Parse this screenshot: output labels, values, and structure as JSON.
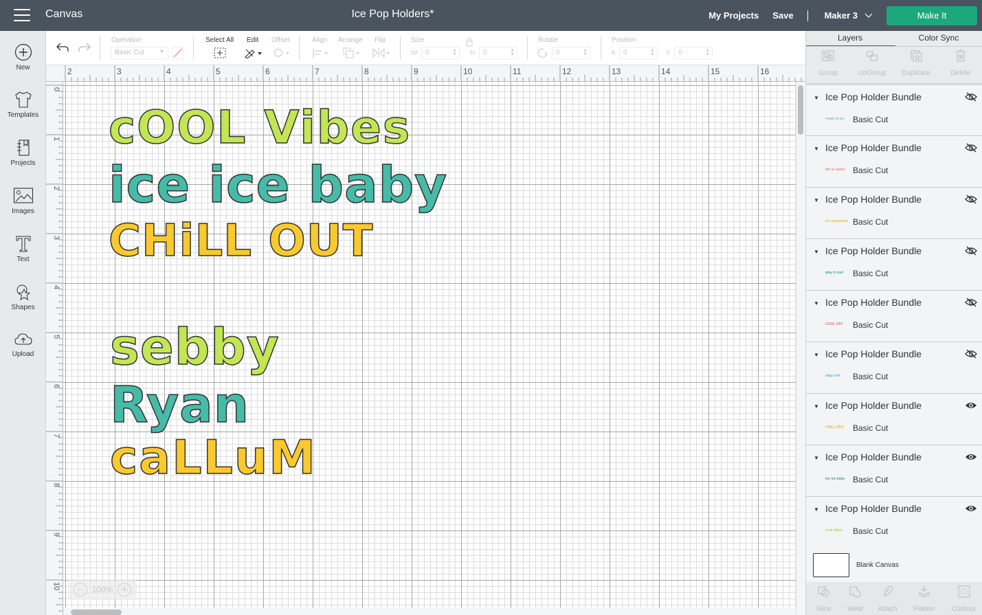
{
  "topbar": {
    "app_title": "Canvas",
    "document_title": "Ice Pop Holders*",
    "my_projects": "My Projects",
    "save": "Save",
    "separator": "|",
    "machine": "Maker 3",
    "make_it": "Make It"
  },
  "sidebar": {
    "items": [
      {
        "label": "New",
        "icon": "plus-circle-icon"
      },
      {
        "label": "Templates",
        "icon": "tshirt-icon"
      },
      {
        "label": "Projects",
        "icon": "notebook-icon"
      },
      {
        "label": "Images",
        "icon": "image-icon"
      },
      {
        "label": "Text",
        "icon": "text-icon"
      },
      {
        "label": "Shapes",
        "icon": "shapes-icon"
      },
      {
        "label": "Upload",
        "icon": "upload-cloud-icon"
      }
    ]
  },
  "toolbar": {
    "operation_label": "Operation",
    "operation_value": "Basic Cut",
    "select_all": "Select All",
    "edit": "Edit",
    "offset": "Offset",
    "align": "Align",
    "arrange": "Arrange",
    "flip": "Flip",
    "size": "Size",
    "w_label": "W",
    "w_value": "0",
    "h_label": "H",
    "h_value": "0",
    "rotate": "Rotate",
    "rotate_value": "0",
    "position": "Position",
    "x_label": "X",
    "x_value": "0",
    "y_label": "Y",
    "y_value": "0"
  },
  "rulers": {
    "top": [
      "2",
      "3",
      "4",
      "5",
      "6",
      "7",
      "8",
      "9",
      "10",
      "11",
      "12",
      "13",
      "14",
      "15",
      "16"
    ],
    "left": [
      "0",
      "1",
      "2",
      "3",
      "4",
      "5",
      "6",
      "7",
      "8",
      "9",
      "10"
    ]
  },
  "canvas": {
    "designs": [
      {
        "text": "cOOL Vibes",
        "color": "#c2e654"
      },
      {
        "text": "ice ice baby",
        "color": "#45bba8"
      },
      {
        "text": "CHiLL OUT",
        "color": "#f9c92e"
      },
      {
        "text": "sebby",
        "color": "#c2e654"
      },
      {
        "text": "Ryan",
        "color": "#45bba8"
      },
      {
        "text": "caLLuM",
        "color": "#f9c92e"
      }
    ],
    "zoom_level": "100%",
    "zoom_out": "−",
    "zoom_in": "+"
  },
  "panel": {
    "tabs": [
      "Layers",
      "Color Sync"
    ],
    "tools": [
      "Group",
      "UnGroup",
      "Duplicate",
      "Delete"
    ],
    "layers": [
      {
        "name": "Ice Pop Holder Bundle",
        "sub": "Basic Cut",
        "thumb": "ready to po",
        "thumb_color": "#7fc9b5",
        "visible": false
      },
      {
        "name": "Ice Pop Holder Bundle",
        "sub": "Basic Cut",
        "thumb": "life is sweet",
        "thumb_color": "#e08a8a",
        "visible": false
      },
      {
        "name": "Ice Pop Holder Bundle",
        "sub": "Basic Cut",
        "thumb": "ice pop posse",
        "thumb_color": "#e2c046",
        "visible": false
      },
      {
        "name": "Ice Pop Holder Bundle",
        "sub": "Basic Cut",
        "thumb": "play it cool",
        "thumb_color": "#3aa89a",
        "visible": false
      },
      {
        "name": "Ice Pop Holder Bundle",
        "sub": "Basic Cut",
        "thumb": "COOL OFF",
        "thumb_color": "#e07a7a",
        "visible": false
      },
      {
        "name": "Ice Pop Holder Bundle",
        "sub": "Basic Cut",
        "thumb": "stay cool",
        "thumb_color": "#5ab8c8",
        "visible": false
      },
      {
        "name": "Ice Pop Holder Bundle",
        "sub": "Basic Cut",
        "thumb": "CHiLL OUT",
        "thumb_color": "#e2b830",
        "visible": true
      },
      {
        "name": "Ice Pop Holder Bundle",
        "sub": "Basic Cut",
        "thumb": "ice ice baby",
        "thumb_color": "#3aa89a",
        "visible": true
      },
      {
        "name": "Ice Pop Holder Bundle",
        "sub": "Basic Cut",
        "thumb": "cool vibes",
        "thumb_color": "#b5d84a",
        "visible": true
      }
    ],
    "blank_canvas": "Blank Canvas",
    "bottom_tools": [
      "Slice",
      "Weld",
      "Attach",
      "Flatten",
      "Contour"
    ]
  },
  "colors": {
    "topbar": "#4a545e",
    "make_it": "#1ca77c"
  }
}
